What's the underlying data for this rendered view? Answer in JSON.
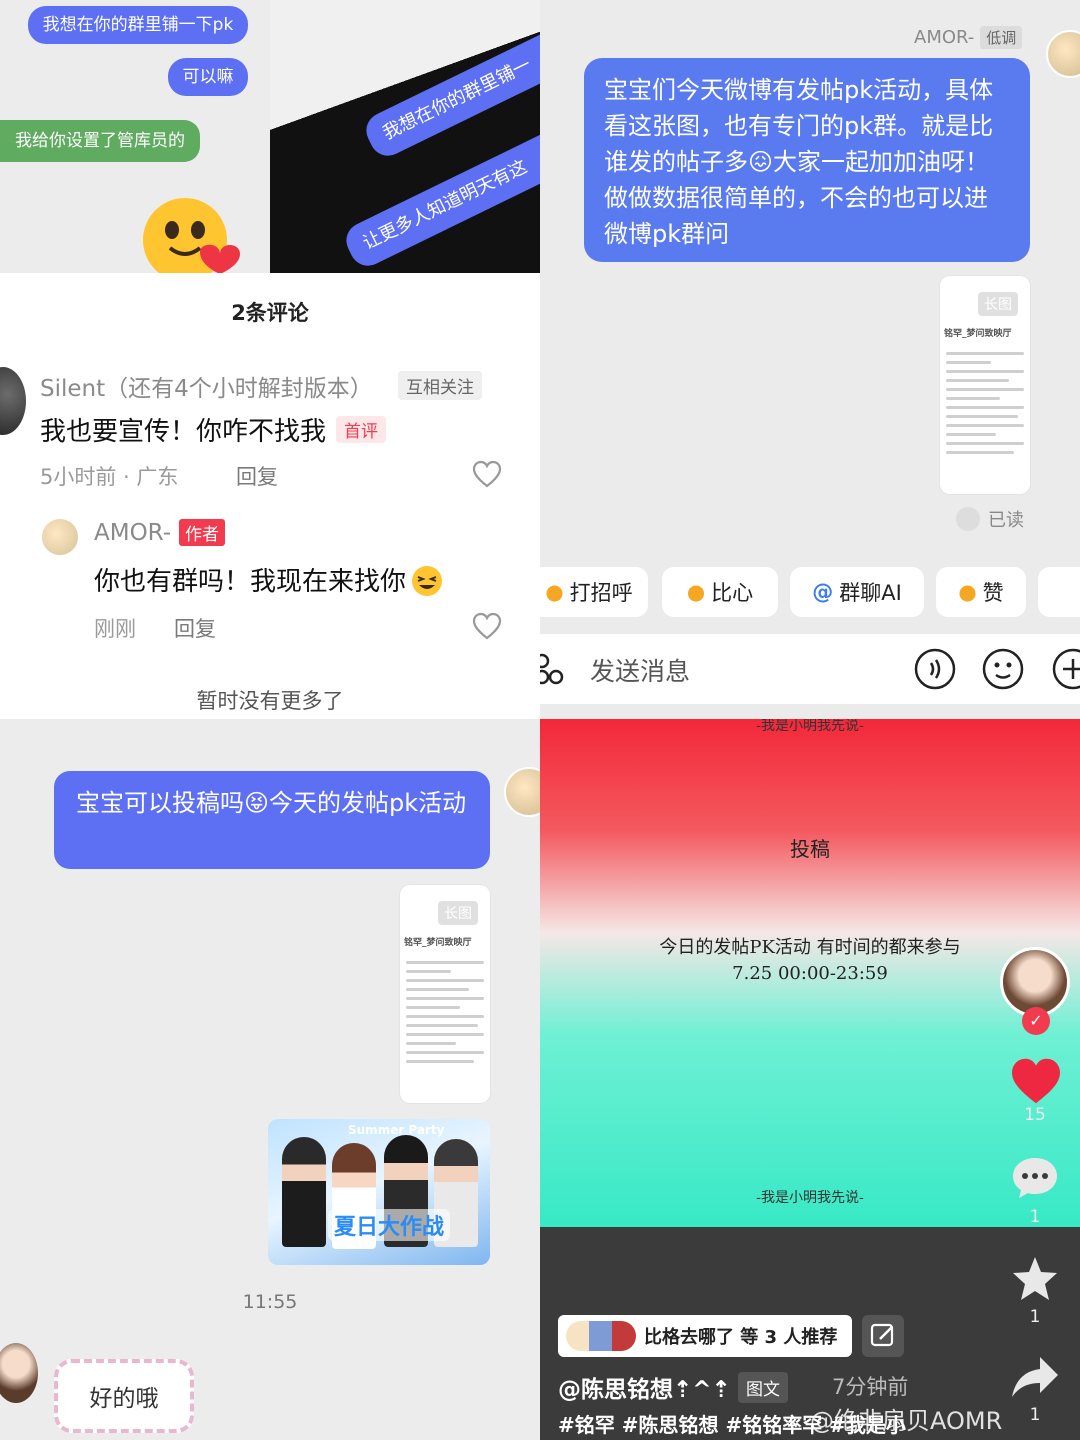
{
  "top_left": {
    "chat_bubbles": [
      "我想在你的群里铺一下pk",
      "可以嘛",
      "我给你设置了管库员的"
    ],
    "tilted_bubbles": [
      "我想在你的群里铺一",
      "让更多人知道明天有这"
    ]
  },
  "comments_panel": {
    "title": "2条评论",
    "comment1": {
      "username": "Silent（还有4个小时解封版本）",
      "relation_badge": "互相关注",
      "text": "我也要宣传！你咋不找我",
      "first_badge": "首评",
      "meta": "5小时前 · 广东",
      "reply": "回复"
    },
    "comment2": {
      "username": "AMOR-",
      "author_badge": "作者",
      "text": "你也有群吗！我现在来找你",
      "time": "刚刚",
      "reply": "回复"
    },
    "no_more": "暂时没有更多了"
  },
  "top_right": {
    "sender": "AMOR-",
    "sender_tag": "低调",
    "message": "宝宝们今天微博有发帖pk活动，具体看这张图，也有专门的pk群。就是比谁发的帖子多😖大家一起加加油呀！做做数据很简单的，不会的也可以进微博pk群问",
    "image_tag": "长图",
    "doc_title": "铭罕_梦问致映厅",
    "read_status": "已读",
    "quick_chips": [
      "打招呼",
      "比心",
      "群聊AI",
      "赞"
    ],
    "input_placeholder": "发送消息"
  },
  "bottom_left": {
    "message": "宝宝可以投稿吗😝今天的发帖pk活动",
    "image_tag": "长图",
    "doc_title": "铭罕_梦问致映厅",
    "poster_title": "夏日大作战",
    "poster_sub": "Summer Party",
    "time": "11:55",
    "reply_sticker": "好的哦"
  },
  "bottom_right": {
    "top_caption": "-我是小明我先说-",
    "heading": "投稿",
    "line1": "今日的发帖PK活动 有时间的都来参与",
    "line2": "7.25 00:00-23:59",
    "bottom_caption": "-我是小明我先说-",
    "like_count": "15",
    "comment_count": "1",
    "star_count": "1",
    "share_count": "1",
    "recommend": "比格去哪了 等 3 人推荐",
    "author": "@陈思铭想⇡^⇡",
    "type_badge": "图文",
    "post_time": "7分钟前",
    "hashtags": "#铭罕 #陈思铭想 #铭铭率罕 #我是小",
    "watermark": "@绝非扇贝AOMR"
  },
  "colors": {
    "bubble_blue": "#5a7bef",
    "bubble_green": "#5fab5f",
    "author_red": "#f23b4f",
    "heart_red": "#ee2840",
    "gradient_top": "#f3283a",
    "gradient_bottom": "#37e9c6"
  },
  "icons": [
    "heart-outline-icon",
    "voice-icon",
    "emoji-icon",
    "plus-icon",
    "star-icon",
    "share-icon",
    "comment-bubble-icon",
    "edit-icon",
    "grid-icon"
  ]
}
